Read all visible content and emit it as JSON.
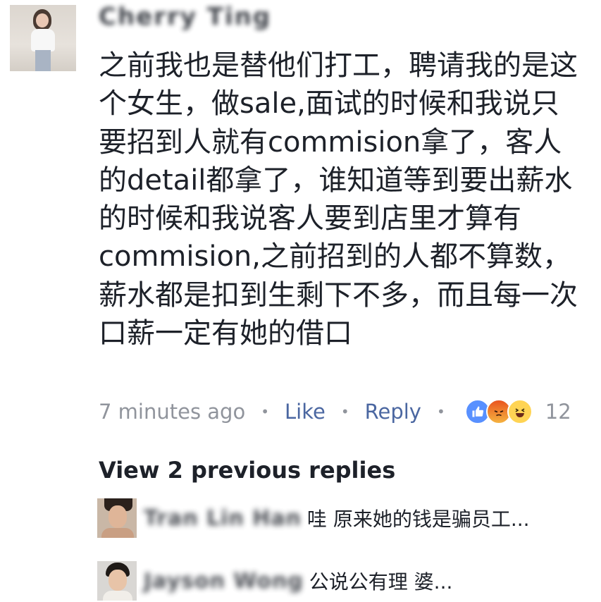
{
  "comment": {
    "author": "Cherry Ting",
    "text": "之前我也是替他们打工，聘请我的是这个女生，做sale,面试的时候和我说只要招到人就有commision拿了，客人的detail都拿了，谁知道等到要出薪水的时候和我说客人要到店里才算有commision,之前招到的人都不算数，薪水都是扣到生剩下不多，而且每一次口薪一定有她的借口",
    "timestamp": "7 minutes ago",
    "like_label": "Like",
    "reply_label": "Reply",
    "separator": "•",
    "reactions": {
      "icons": [
        "like-icon",
        "angry-icon",
        "haha-icon"
      ],
      "count": "12"
    }
  },
  "view_replies_label": "View 2 previous replies",
  "replies": [
    {
      "author": "Tran Lin Han",
      "preview": "哇 原来她的钱是骗员工..."
    },
    {
      "author": "Jayson Wong",
      "preview": "公说公有理 婆..."
    }
  ],
  "colors": {
    "text": "#1d2129",
    "meta": "#90949c",
    "link": "#4b67a1",
    "like_blue": "#5890ff"
  }
}
